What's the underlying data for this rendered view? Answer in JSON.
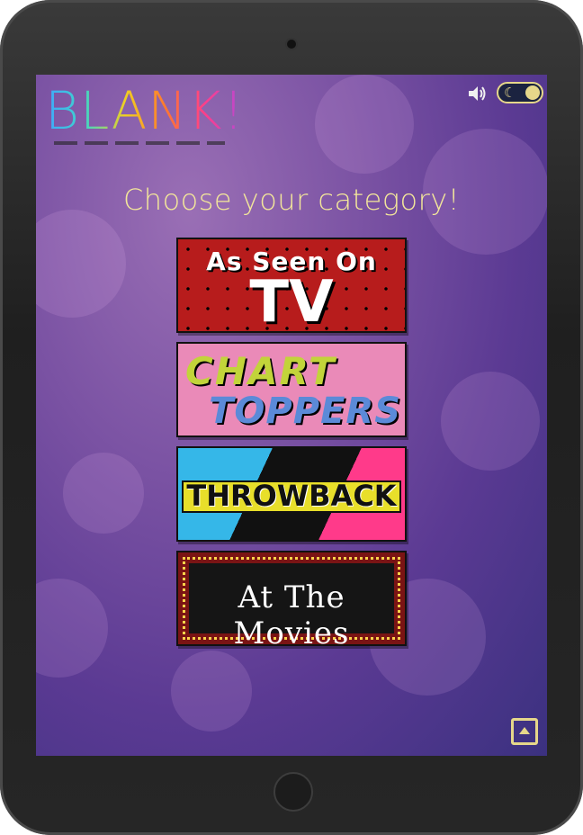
{
  "app": {
    "logo_text": "BLANK!",
    "heading": "Choose your category!"
  },
  "controls": {
    "sound_icon": "speaker-icon",
    "theme_toggle_icon": "moon-icon",
    "scroll_top_icon": "arrow-up-icon"
  },
  "categories": [
    {
      "id": "tv",
      "line1": "As Seen On",
      "line2": "TV"
    },
    {
      "id": "chart",
      "line1": "CHART",
      "line2": "TOPPERS"
    },
    {
      "id": "throwback",
      "line1": "THROWBACK"
    },
    {
      "id": "movies",
      "line1": "At The Movies"
    }
  ],
  "colors": {
    "accent": "#e6d78a",
    "heading": "#f3e79a",
    "tv_bg": "#b71c1c",
    "chart_bg": "#ea8ab8",
    "movies_bg": "#7a1414"
  }
}
